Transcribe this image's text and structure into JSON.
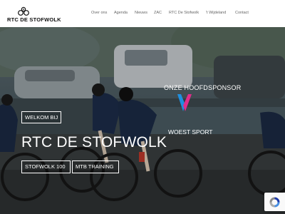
{
  "brand": {
    "name": "RTC DE STOFWOLK"
  },
  "nav": {
    "items": [
      {
        "label": "Over ons"
      },
      {
        "label": "Agenda"
      },
      {
        "label": "Nieuws"
      },
      {
        "label": "ZAC"
      },
      {
        "label": "RTC De Stofwolk"
      },
      {
        "label": "'t Wijdeland"
      },
      {
        "label": "Contact"
      }
    ]
  },
  "hero": {
    "welcome": "WELKOM BIJ",
    "title": "RTC DE STOFWOLK",
    "buttons": [
      {
        "label": "STOFWOLK 100"
      },
      {
        "label": "MTB TRAINING"
      }
    ],
    "sponsor_label": "ONZE HOOFDSPONSOR",
    "sponsor_name": "WOEST SPORT"
  },
  "colors": {
    "sponsor_v_left": "#1f8fe0",
    "sponsor_v_right": "#e02d8a",
    "text_on_hero": "#ffffff"
  },
  "icons": {
    "logo_mark": "cyclist-wheels-icon",
    "recaptcha": "recaptcha-icon"
  }
}
